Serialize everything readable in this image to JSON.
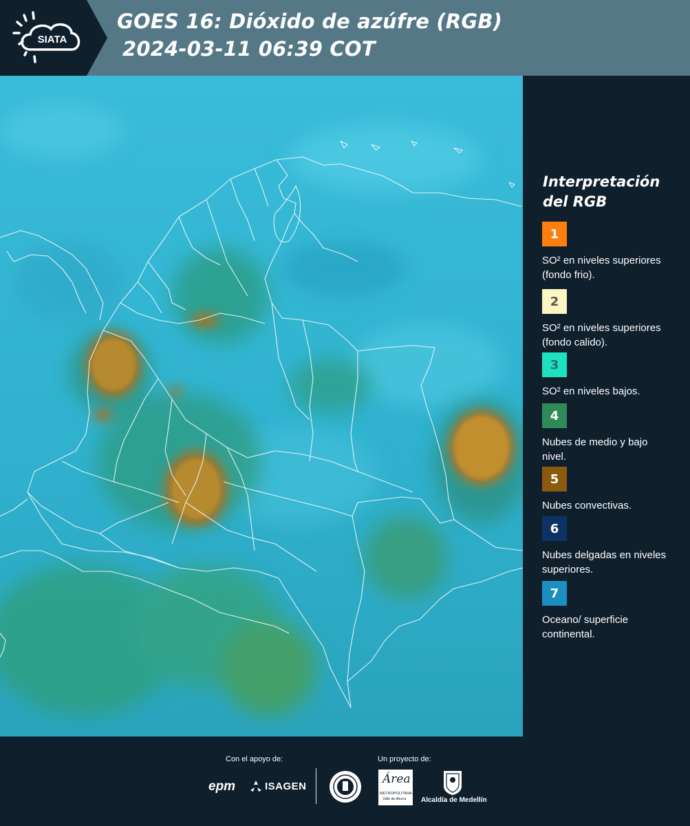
{
  "header": {
    "logo_text": "SIATA",
    "title_line1": "GOES 16: Dióxido de azúfre (RGB)",
    "title_line2": "2024-03-11 06:39 COT"
  },
  "legend": {
    "title": "Interpretación del RGB",
    "items": [
      {
        "number": "1",
        "label": "SO² en niveles superiores (fondo frio).",
        "color": "#ff7f0e",
        "text_color": "#ffffff"
      },
      {
        "number": "2",
        "label": "SO² en niveles superiores (fondo calido).",
        "color": "#fdf6c3",
        "text_color": "#555555"
      },
      {
        "number": "3",
        "label": "SO² en niveles bajos.",
        "color": "#1de2c0",
        "text_color": "#2e6a6a"
      },
      {
        "number": "4",
        "label": "Nubes de medio y bajo nivel.",
        "color": "#2e8b57",
        "text_color": "#ffffff"
      },
      {
        "number": "5",
        "label": "Nubes convectivas.",
        "color": "#8c5a0f",
        "text_color": "#ffffff"
      },
      {
        "number": "6",
        "label": "Nubes delgadas en niveles superiores.",
        "color": "#0d3364",
        "text_color": "#ffffff"
      },
      {
        "number": "7",
        "label": "Oceano/ superficie continental.",
        "color": "#1a8fc0",
        "text_color": "#ffffff"
      }
    ]
  },
  "footer": {
    "support_label": "Con el apoyo de:",
    "project_label": "Un proyecto de:",
    "epm": "epm",
    "isagen": "ISAGEN",
    "area_logo": "Área",
    "area_subtext": "METROPOLITANA",
    "area_subtext2": "Valle de Aburrá",
    "alcaldia": "Alcaldía de Medellín"
  },
  "colors": {
    "header_bg": "#547886",
    "page_bg": "#0f1f2c",
    "map_base": "#36b9d8"
  }
}
